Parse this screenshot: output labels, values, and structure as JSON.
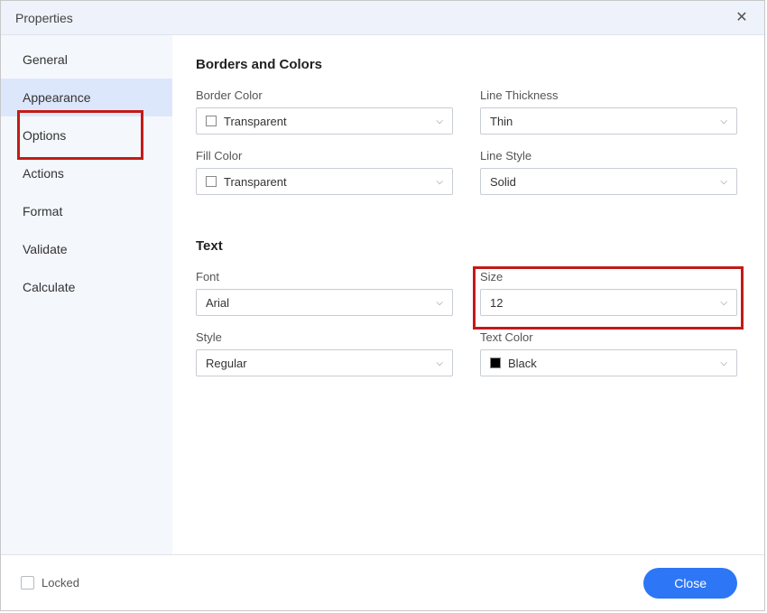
{
  "title": "Properties",
  "sidebar": {
    "items": [
      {
        "label": "General"
      },
      {
        "label": "Appearance"
      },
      {
        "label": "Options"
      },
      {
        "label": "Actions"
      },
      {
        "label": "Format"
      },
      {
        "label": "Validate"
      },
      {
        "label": "Calculate"
      }
    ],
    "active_index": 1
  },
  "sections": {
    "borders": {
      "title": "Borders and Colors",
      "border_color": {
        "label": "Border Color",
        "value": "Transparent"
      },
      "line_thickness": {
        "label": "Line Thickness",
        "value": "Thin"
      },
      "fill_color": {
        "label": "Fill Color",
        "value": "Transparent"
      },
      "line_style": {
        "label": "Line Style",
        "value": "Solid"
      }
    },
    "text": {
      "title": "Text",
      "font": {
        "label": "Font",
        "value": "Arial"
      },
      "size": {
        "label": "Size",
        "value": "12"
      },
      "style": {
        "label": "Style",
        "value": "Regular"
      },
      "text_color": {
        "label": "Text Color",
        "value": "Black"
      }
    }
  },
  "footer": {
    "locked_label": "Locked",
    "close_label": "Close"
  }
}
